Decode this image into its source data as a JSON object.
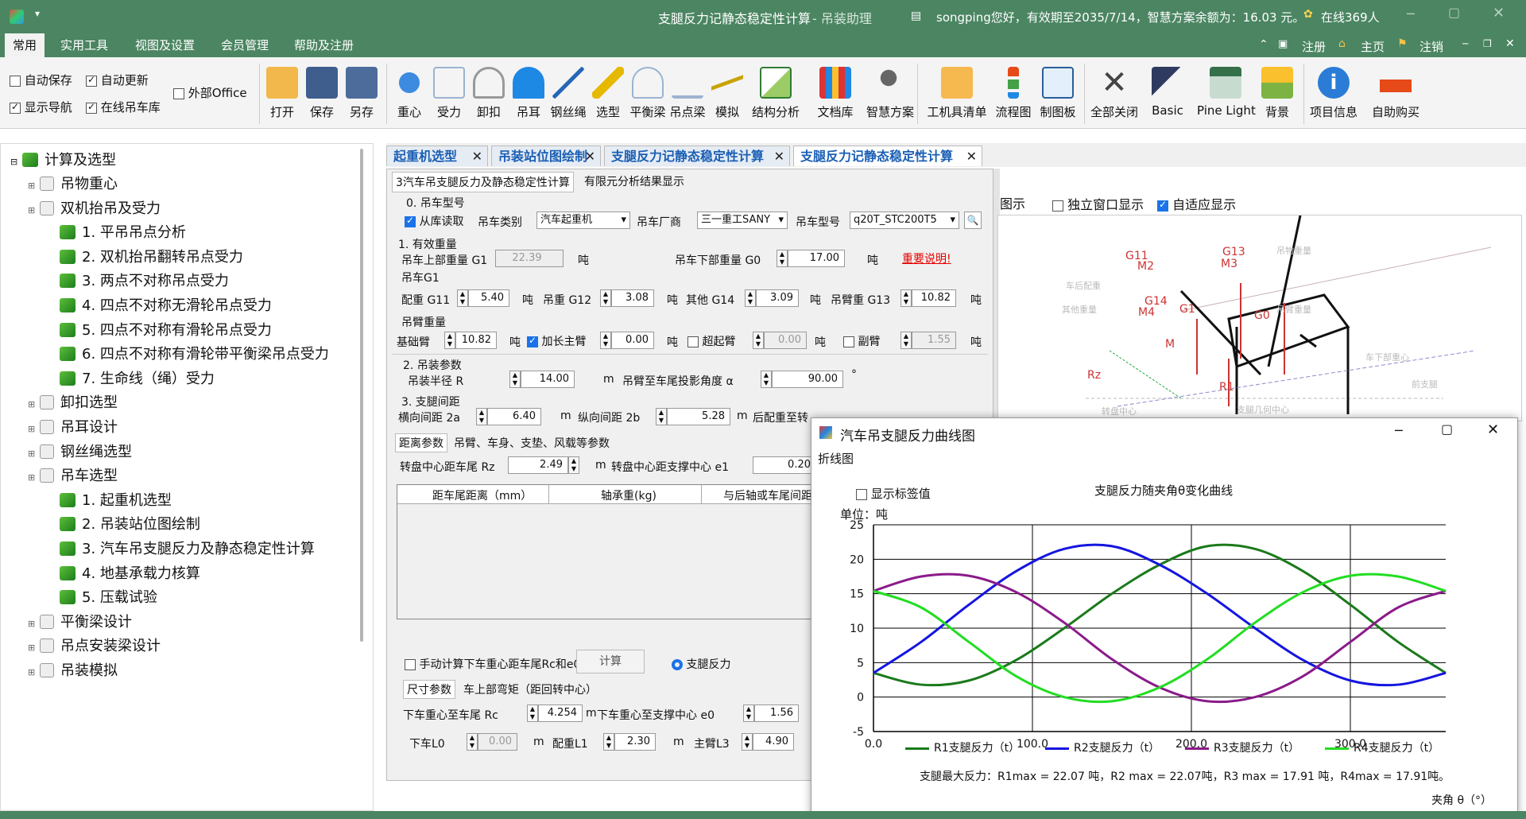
{
  "titlebar": {
    "title": "支腿反力记静态稳定性计算",
    "app": " - 吊装助理",
    "user_info": "songping您好，有效期至2035/7/14，智慧方案余额为：16.03 元。",
    "online": "在线369人"
  },
  "menubar": {
    "tabs": [
      "常用",
      "实用工具",
      "视图及设置",
      "会员管理",
      "帮助及注册"
    ],
    "right": [
      "注册",
      "主页",
      "注销"
    ]
  },
  "ribbon": {
    "options": [
      "自动保存",
      "自动更新",
      "外部Office",
      "显示导航",
      "在线吊车库"
    ],
    "file_buttons": [
      "打开",
      "保存",
      "另存"
    ],
    "tool_buttons": [
      "重心",
      "受力",
      "卸扣",
      "吊耳",
      "钢丝绳",
      "选型",
      "平衡梁",
      "吊点梁",
      "模拟",
      "结构分析",
      "文档库",
      "智慧方案"
    ],
    "other_buttons": [
      "工机具清单",
      "流程图",
      "制图板"
    ],
    "view_buttons": [
      "全部关闭",
      "Basic",
      "Pine Light",
      "背景"
    ],
    "info_buttons": [
      "项目信息",
      "自助购买"
    ]
  },
  "tree": {
    "root": "计算及选型",
    "items": [
      {
        "label": "吊物重心",
        "level": 1
      },
      {
        "label": "双机抬吊及受力",
        "level": 1
      },
      {
        "label": "1. 平吊吊点分析",
        "level": 2
      },
      {
        "label": "2. 双机抬吊翻转吊点受力",
        "level": 2
      },
      {
        "label": "3. 两点不对称吊点受力",
        "level": 2
      },
      {
        "label": "4. 四点不对称无滑轮吊点受力",
        "level": 2
      },
      {
        "label": "5. 四点不对称有滑轮吊点受力",
        "level": 2
      },
      {
        "label": "6. 四点不对称有滑轮带平衡梁吊点受力",
        "level": 2
      },
      {
        "label": "7. 生命线（绳）受力",
        "level": 2
      },
      {
        "label": "卸扣选型",
        "level": 1
      },
      {
        "label": "吊耳设计",
        "level": 1
      },
      {
        "label": "钢丝绳选型",
        "level": 1
      },
      {
        "label": "吊车选型",
        "level": 1
      },
      {
        "label": "1. 起重机选型",
        "level": 2
      },
      {
        "label": "2. 吊装站位图绘制",
        "level": 2
      },
      {
        "label": "3. 汽车吊支腿反力及静态稳定性计算",
        "level": 2
      },
      {
        "label": "4. 地基承载力核算",
        "level": 2
      },
      {
        "label": "5. 压载试验",
        "level": 2
      },
      {
        "label": "平衡梁设计",
        "level": 1
      },
      {
        "label": "吊点安装梁设计",
        "level": 1
      },
      {
        "label": "吊装模拟",
        "level": 1
      }
    ]
  },
  "doctabs": [
    "起重机选型",
    "吊装站位图绘制",
    "支腿反力记静态稳定性计算",
    "支腿反力记静态稳定性计算"
  ],
  "subtabs": [
    "3汽车吊支腿反力及静态稳定性计算",
    "有限元分析结果显示"
  ],
  "form": {
    "s0": "0. 吊车型号",
    "from_lib": "从库读取",
    "crane_type_label": "吊车类别",
    "crane_type": "汽车起重机",
    "maker_label": "吊车厂商",
    "maker": "三一重工SANY",
    "model_label": "吊车型号",
    "model": "q20T_STC200T5",
    "s1": "1. 有效重量",
    "g1_label": "吊车上部重量 G1",
    "g1": "22.39",
    "ton": "吨",
    "g0_label": "吊车下部重量 G0",
    "g0": "17.00",
    "important": "重要说明!",
    "g1_group": "吊车G1",
    "g11_label": "配重 G11",
    "g11": "5.40",
    "g12_label": "吊重 G12",
    "g12": "3.08",
    "g14_label": "其他 G14",
    "g14": "3.09",
    "g13_label": "吊臂重 G13",
    "g13": "10.82",
    "boom_group": "吊臂重量",
    "base_label": "基础臂",
    "base": "10.82",
    "ext_label": "加长主臂",
    "ext": "0.00",
    "super_label": "超起臂",
    "super": "0.00",
    "jib_label": "副臂",
    "jib": "1.55",
    "s2": "2. 吊装参数",
    "radius_label": "吊装半径 R",
    "radius": "14.00",
    "m": "m",
    "angle_label": "吊臂至车尾投影角度 α",
    "angle": "90.00",
    "deg": "°",
    "s3": "3. 支腿间距",
    "lat_label": "横向间距 2a",
    "lat": "6.40",
    "lon_label": "纵向间距 2b",
    "lon": "5.28",
    "rear_label": "后配重至转",
    "ptabs": [
      "距离参数",
      "吊臂、车身、支垫、风载等参数"
    ],
    "rz_label": "转盘中心距车尾 Rz",
    "rz": "2.49",
    "e1_label": "转盘中心距支撑中心 e1",
    "e1": "0.20",
    "table_headers": [
      "距车尾距离（mm）",
      "轴承重(kg)",
      "与后轴或车尾间距"
    ],
    "manual": "手动计算下车重心距车尾Rc和e0",
    "calc": "计算",
    "radio": "支腿反力",
    "btabs": [
      "尺寸参数",
      "车上部弯矩（距回转中心）"
    ],
    "rc_label": "下车重心至车尾 Rc",
    "rc": "4.254",
    "e0_label": "下车重心至支撑中心 e0",
    "e0": "1.56",
    "l0_label": "下车L0",
    "l0": "0.00",
    "l1_label": "配重L1",
    "l1": "2.30",
    "l3_label": "主臂L3",
    "l3": "4.90"
  },
  "diagram": {
    "header": "图示",
    "opt1": "独立窗口显示",
    "opt2": "自适应显示",
    "labels": [
      "G11",
      "M2",
      "G13",
      "M3",
      "G14",
      "M4",
      "G1",
      "G0",
      "M",
      "R1",
      "Rz",
      "吊物重量",
      "车后配重",
      "其他重量",
      "吊臂重量",
      "车下部重心",
      "前支腿",
      "转盘中心",
      "支腿几何中心"
    ]
  },
  "popup": {
    "title": "汽车吊支腿反力曲线图",
    "tab": "折线图",
    "show_values": "显示标签值",
    "unit": "单位：吨",
    "summary": "支腿最大反力：R1max = 22.07 吨，R2 max = 22.07吨，R3 max = 17.91 吨，R4max = 17.91吨。",
    "xaxis": "夹角 θ（°）"
  },
  "chart_data": {
    "type": "line",
    "title": "支腿反力随夹角θ变化曲线",
    "ylabel": "单位：吨",
    "xlabel": "夹角 θ（°）",
    "xlim": [
      0,
      360
    ],
    "ylim": [
      -5,
      25
    ],
    "yticks": [
      -5,
      0,
      5,
      10,
      15,
      20,
      25
    ],
    "xticks": [
      0,
      100,
      200,
      300
    ],
    "xtick_labels": [
      "0.0",
      "100.0",
      "200.0",
      "300.0"
    ],
    "grid": true,
    "legend": "bottom",
    "x": [
      0,
      30,
      60,
      90,
      120,
      150,
      180,
      210,
      240,
      270,
      300,
      330,
      360
    ],
    "series": [
      {
        "name": "R1支腿反力（t）",
        "color": "#1a7a1a",
        "values": [
          3.5,
          1.8,
          2.4,
          5.4,
          10.0,
          15.0,
          19.2,
          21.9,
          21.5,
          18.3,
          13.4,
          8.0,
          3.5
        ]
      },
      {
        "name": "R2支腿反力（t）",
        "color": "#1515e0",
        "values": [
          3.5,
          8.0,
          13.4,
          18.3,
          21.5,
          21.9,
          19.2,
          15.0,
          10.0,
          5.4,
          2.4,
          1.8,
          3.5
        ]
      },
      {
        "name": "R3支腿反力（t）",
        "color": "#8b1a8b",
        "values": [
          15.4,
          17.5,
          17.6,
          15.2,
          10.8,
          5.5,
          1.4,
          -0.6,
          0.0,
          3.0,
          8.0,
          13.0,
          15.4
        ]
      },
      {
        "name": "R4支腿反力（t）",
        "color": "#22dd22",
        "values": [
          15.4,
          13.0,
          8.0,
          3.0,
          0.0,
          -0.6,
          1.4,
          5.5,
          10.8,
          15.2,
          17.6,
          17.5,
          15.4
        ]
      }
    ]
  }
}
